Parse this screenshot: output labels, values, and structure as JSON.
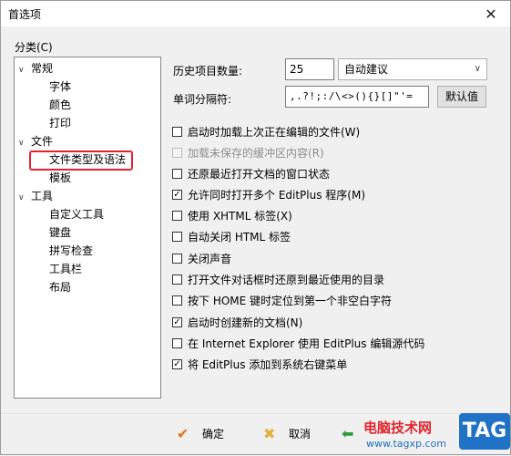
{
  "window": {
    "title": "首选项",
    "close_glyph": "✕"
  },
  "sidebar": {
    "label": "分类(C)",
    "items": [
      {
        "label": "常规",
        "level": 0,
        "expanded": true
      },
      {
        "label": "字体",
        "level": 1
      },
      {
        "label": "颜色",
        "level": 1
      },
      {
        "label": "打印",
        "level": 1
      },
      {
        "label": "文件",
        "level": 0,
        "expanded": true
      },
      {
        "label": "文件类型及语法",
        "level": 1,
        "highlighted": true
      },
      {
        "label": "模板",
        "level": 1
      },
      {
        "label": "工具",
        "level": 0,
        "expanded": true
      },
      {
        "label": "自定义工具",
        "level": 1
      },
      {
        "label": "键盘",
        "level": 1
      },
      {
        "label": "拼写检查",
        "level": 1
      },
      {
        "label": "工具栏",
        "level": 1
      },
      {
        "label": "布局",
        "level": 1
      }
    ]
  },
  "settings": {
    "history_label": "历史项目数量:",
    "history_value": "25",
    "history_mode": "自动建议",
    "word_sep_label": "单词分隔符:",
    "word_sep_value": ",.?!;:/\\<>(){}[]\"'=",
    "default_button": "默认值"
  },
  "checkboxes": [
    {
      "label": "启动时加载上次正在编辑的文件(W)",
      "checked": false,
      "disabled": false
    },
    {
      "label": "加载未保存的缓冲区内容(R)",
      "checked": false,
      "disabled": true
    },
    {
      "label": "还原最近打开文档的窗口状态",
      "checked": false,
      "disabled": false
    },
    {
      "label": "允许同时打开多个 EditPlus 程序(M)",
      "checked": true,
      "disabled": false
    },
    {
      "label": "使用 XHTML 标签(X)",
      "checked": false,
      "disabled": false
    },
    {
      "label": "自动关闭 HTML 标签",
      "checked": false,
      "disabled": false
    },
    {
      "label": "关闭声音",
      "checked": false,
      "disabled": false
    },
    {
      "label": "打开文件对话框时还原到最近使用的目录",
      "checked": false,
      "disabled": false
    },
    {
      "label": "按下 HOME 键时定位到第一个非空白字符",
      "checked": false,
      "disabled": false
    },
    {
      "label": "启动时创建新的文档(N)",
      "checked": true,
      "disabled": false
    },
    {
      "label": "在 Internet Explorer 使用 EditPlus 编辑源代码",
      "checked": false,
      "disabled": false
    },
    {
      "label": "将 EditPlus 添加到系统右键菜单",
      "checked": true,
      "disabled": false
    }
  ],
  "footer": {
    "ok_label": "确定",
    "cancel_label": "取消"
  },
  "watermark": {
    "site_name": "电脑技术网",
    "url": "www.tagxp.com",
    "badge": "TAG"
  },
  "colors": {
    "highlight_border": "#e0242c",
    "ok_icon": "#e8731f",
    "cancel_icon": "#e0b23a",
    "apply_icon": "#2e9b3a"
  }
}
